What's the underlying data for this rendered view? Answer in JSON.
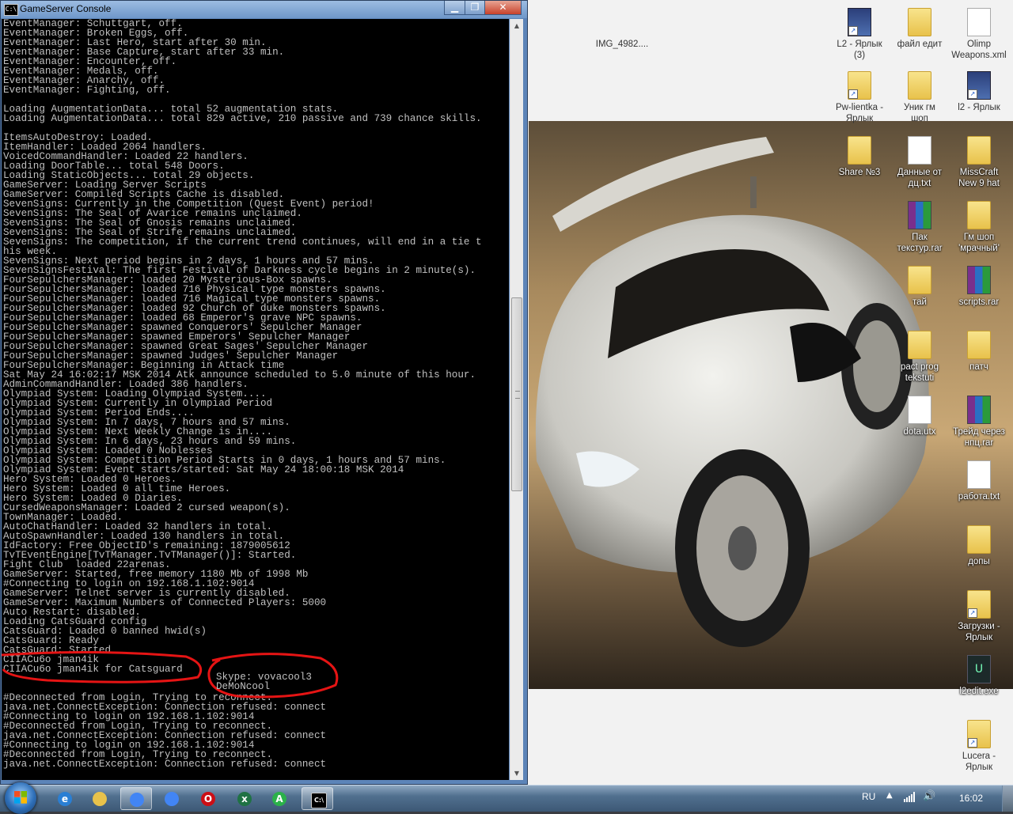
{
  "console": {
    "title": "GameServer Console",
    "icon_label": "C:\\",
    "lines": [
      "EventManager: Schuttgart, off.",
      "EventManager: Broken Eggs, off.",
      "EventManager: Last Hero, start after 30 min.",
      "EventManager: Base Capture, start after 33 min.",
      "EventManager: Encounter, off.",
      "EventManager: Medals, off.",
      "EventManager: Anarchy, off.",
      "EventManager: Fighting, off.",
      "",
      "Loading AugmentationData... total 52 augmentation stats.",
      "Loading AugmentationData... total 829 active, 210 passive and 739 chance skills.",
      "",
      "ItemsAutoDestroy: Loaded.",
      "ItemHandler: Loaded 2064 handlers.",
      "VoicedCommandHandler: Loaded 22 handlers.",
      "Loading DoorTable... total 548 Doors.",
      "Loading StaticObjects... total 29 objects.",
      "GameServer: Loading Server Scripts",
      "GameServer: Compiled Scripts Cache is disabled.",
      "SevenSigns: Currently in the Competition (Quest Event) period!",
      "SevenSigns: The Seal of Avarice remains unclaimed.",
      "SevenSigns: The Seal of Gnosis remains unclaimed.",
      "SevenSigns: The Seal of Strife remains unclaimed.",
      "SevenSigns: The competition, if the current trend continues, will end in a tie t",
      "his week.",
      "SevenSigns: Next period begins in 2 days, 1 hours and 57 mins.",
      "SevenSignsFestival: The first Festival of Darkness cycle begins in 2 minute(s).",
      "FourSepulchersManager: loaded 20 Mysterious-Box spawns.",
      "FourSepulchersManager: loaded 716 Physical type monsters spawns.",
      "FourSepulchersManager: loaded 716 Magical type monsters spawns.",
      "FourSepulchersManager: loaded 92 Church of duke monsters spawns.",
      "FourSepulchersManager: loaded 68 Emperor's grave NPC spawns.",
      "FourSepulchersManager: spawned Conquerors' Sepulcher Manager",
      "FourSepulchersManager: spawned Emperors' Sepulcher Manager",
      "FourSepulchersManager: spawned Great Sages' Sepulcher Manager",
      "FourSepulchersManager: spawned Judges' Sepulcher Manager",
      "FourSepulchersManager: Beginning in Attack time",
      "Sat May 24 16:02:17 MSK 2014 Atk announce scheduled to 5.0 minute of this hour.",
      "AdminCommandHandler: Loaded 386 handlers.",
      "Olympiad System: Loading Olympiad System....",
      "Olympiad System: Currently in Olympiad Period",
      "Olympiad System: Period Ends....",
      "Olympiad System: In 7 days, 7 hours and 57 mins.",
      "Olympiad System: Next Weekly Change is in....",
      "Olympiad System: In 6 days, 23 hours and 59 mins.",
      "Olympiad System: Loaded 0 Noblesses",
      "Olympiad System: Competition Period Starts in 0 days, 1 hours and 57 mins.",
      "Olympiad System: Event starts/started: Sat May 24 18:00:18 MSK 2014",
      "Hero System: Loaded 0 Heroes.",
      "Hero System: Loaded 0 all time Heroes.",
      "Hero System: Loaded 0 Diaries.",
      "CursedWeaponsManager: Loaded 2 cursed weapon(s).",
      "TownManager: Loaded.",
      "AutoChatHandler: Loaded 32 handlers in total.",
      "AutoSpawnHandler: Loaded 130 handlers in total.",
      "IdFactory: Free ObjectID's remaining: 1879005612",
      "TvTEventEngine[TvTManager.TvTManager()]: Started.",
      "Fight Club  loaded 22arenas.",
      "GameServer: Started, free memory 1180 Mb of 1998 Mb",
      "#Connecting to login on 192.168.1.102:9014",
      "GameServer: Telnet server is currently disabled.",
      "GameServer: Maximum Numbers of Connected Players: 5000",
      "Auto Restart: disabled.",
      "Loading CatsGuard config",
      "CatsGuard: Loaded 0 banned hwid(s)",
      "CatsGuard: Ready",
      "CatsGuard: Started",
      "CIIACu6o jman4ik",
      "CIIACu6o jman4ik for Catsguard",
      "",
      "",
      "#Deconnected from Login, Trying to reconnect.",
      "java.net.ConnectException: Connection refused: connect",
      "#Connecting to login on 192.168.1.102:9014",
      "#Deconnected from Login, Trying to reconnect.",
      "java.net.ConnectException: Connection refused: connect",
      "#Connecting to login on 192.168.1.102:9014",
      "#Deconnected from Login, Trying to reconnect.",
      "java.net.ConnectException: Connection refused: connect"
    ],
    "skype_note": "Skype: vovacool3\nDeMoNcool",
    "scroll_position": 0.49
  },
  "desktop": {
    "icons": [
      {
        "label": "IMG_4982....",
        "kind": "photo"
      },
      {
        "label": "L2 - Ярлык\n(3)",
        "kind": "l2"
      },
      {
        "label": "файл едит",
        "kind": "folder"
      },
      {
        "label": "Olimp\nWeapons.xml",
        "kind": "doc"
      },
      {
        "label": "Pw-lientka -\nЯрлык",
        "kind": "folder"
      },
      {
        "label": "Уник гм\nшоп",
        "kind": "folder"
      },
      {
        "label": "l2 - Ярлык",
        "kind": "l2"
      },
      {
        "label": "Share №3",
        "kind": "folder"
      },
      {
        "label": "Данные от\nдц.txt",
        "kind": "doc"
      },
      {
        "label": "MissCraft\nNew 9 hat",
        "kind": "folder"
      },
      {
        "label": "Пак\nтекстур.rar",
        "kind": "rar"
      },
      {
        "label": "Гм шоп\n'мрачный'",
        "kind": "folder"
      },
      {
        "label": "тай",
        "kind": "folder"
      },
      {
        "label": "scripts.rar",
        "kind": "rar"
      },
      {
        "label": "pact prog\ntekstuti",
        "kind": "folder"
      },
      {
        "label": "патч",
        "kind": "folder"
      },
      {
        "label": "dota.utx",
        "kind": "doc"
      },
      {
        "label": "Трейд через\nнпц.rar",
        "kind": "rar"
      },
      {
        "label": "работа.txt",
        "kind": "doc"
      },
      {
        "label": "допы",
        "kind": "folder"
      },
      {
        "label": "Загрузки -\nЯрлык",
        "kind": "folder"
      },
      {
        "label": "l2edit.exe",
        "kind": "exe"
      },
      {
        "label": "Lucera -\nЯрлык",
        "kind": "folder"
      }
    ]
  },
  "taskbar": {
    "apps": [
      {
        "name": "internet-explorer",
        "glyph": "e",
        "color": "#2a7fd4"
      },
      {
        "name": "explorer",
        "glyph": "",
        "color": "#e8c24b"
      },
      {
        "name": "chrome",
        "glyph": "",
        "color": "#4285f4"
      },
      {
        "name": "chrome-2",
        "glyph": "",
        "color": "#4285f4"
      },
      {
        "name": "opera",
        "glyph": "O",
        "color": "#cc0f16"
      },
      {
        "name": "excel-like",
        "glyph": "x",
        "color": "#1f7244"
      },
      {
        "name": "l2-app",
        "glyph": "A",
        "color": "#2bb14a"
      },
      {
        "name": "console",
        "glyph": "C:\\",
        "color": "#000000"
      }
    ],
    "language": "RU",
    "time": "16:02"
  }
}
